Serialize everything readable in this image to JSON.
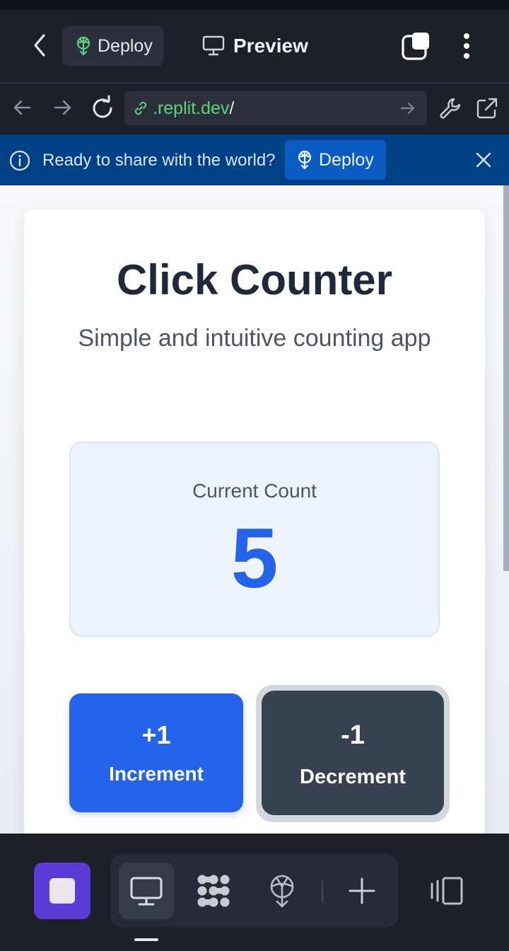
{
  "topbar": {
    "deploy_label": "Deploy",
    "preview_label": "Preview"
  },
  "urlbar": {
    "domain": ".replit.dev",
    "path": "/"
  },
  "banner": {
    "message": "Ready to share with the world?",
    "deploy_label": "Deploy"
  },
  "app": {
    "title": "Click Counter",
    "subtitle": "Simple and intuitive counting app",
    "count_label": "Current Count",
    "count_value": "5",
    "increment_value": "+1",
    "increment_label": "Increment",
    "decrement_value": "-1",
    "decrement_label": "Decrement"
  },
  "colors": {
    "accent_blue": "#2563eb",
    "deploy_green": "#5fd17a",
    "banner_blue": "#004185",
    "stop_purple": "#5b3bd6"
  },
  "icons": [
    "chevron-left-icon",
    "deploy-icon",
    "monitor-icon",
    "tabs-icon",
    "kebab-icon",
    "arrow-left-icon",
    "arrow-right-icon",
    "reload-icon",
    "link-icon",
    "wrench-icon",
    "external-link-icon",
    "info-icon",
    "close-icon",
    "stop-icon",
    "workflow-icon",
    "plus-icon",
    "panels-icon"
  ]
}
